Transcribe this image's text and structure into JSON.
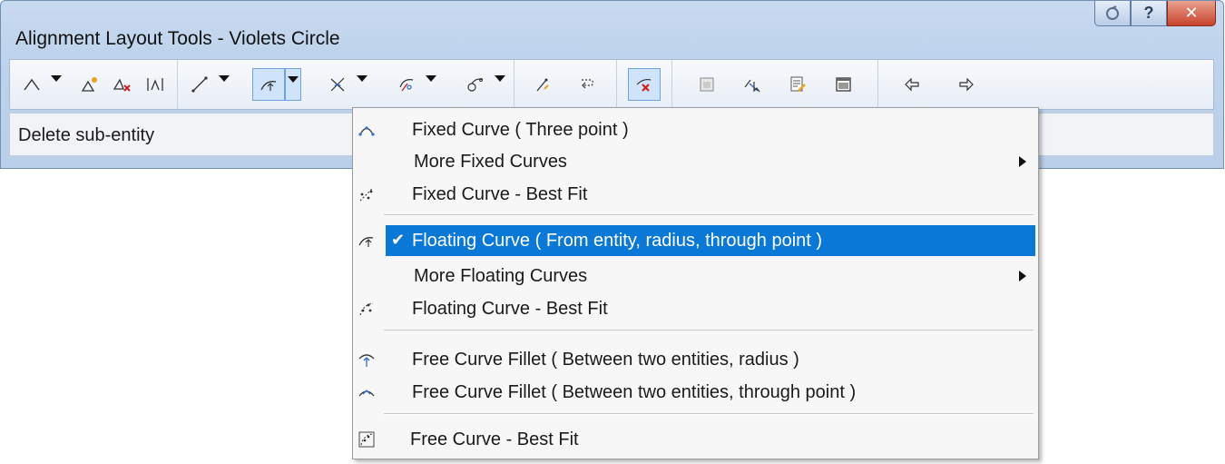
{
  "window": {
    "title": "Alignment Layout Tools - Violets Circle",
    "caption_help": "?",
    "caption_close": "✕"
  },
  "toolbar": {
    "groups": [
      {
        "items": [
          "pi-create-icon",
          "pi-insert-icon",
          "pi-delete-icon",
          "pi-break-icon"
        ]
      },
      {
        "items": [
          "tangent-line-icon",
          "floating-curve-icon",
          "free-curve-icon",
          "spiral-icon",
          "compound-curve-icon"
        ]
      },
      {
        "items": [
          "convert-icon",
          "reverse-icon"
        ]
      },
      {
        "items": [
          "delete-sub-entity-icon"
        ]
      },
      {
        "items": [
          "select-sub-entity-icon",
          "sub-entity-editor-icon",
          "edit-parameters-icon",
          "grid-view-icon"
        ]
      },
      {
        "items": [
          "undo-icon",
          "redo-icon"
        ]
      }
    ],
    "active_tool": "floating-curve-icon"
  },
  "status": {
    "text": "Delete sub-entity"
  },
  "menu": {
    "items": [
      {
        "label": "Fixed Curve ( Three point )",
        "icon": "fixed-curve-three-point-icon",
        "submenu": false
      },
      {
        "label": "More Fixed Curves",
        "icon": "",
        "submenu": true
      },
      {
        "label": "Fixed Curve - Best Fit",
        "icon": "fixed-curve-best-fit-icon",
        "submenu": false
      },
      {
        "label": "Floating Curve ( From entity, radius, through point )",
        "icon": "floating-curve-icon",
        "submenu": false,
        "selected": true
      },
      {
        "label": "More Floating Curves",
        "icon": "",
        "submenu": true
      },
      {
        "label": "Floating Curve - Best Fit",
        "icon": "floating-curve-best-fit-icon",
        "submenu": false
      },
      {
        "label": "Free Curve Fillet ( Between two entities, radius )",
        "icon": "free-curve-fillet-radius-icon",
        "submenu": false
      },
      {
        "label": "Free Curve Fillet ( Between two entities, through point )",
        "icon": "free-curve-fillet-point-icon",
        "submenu": false
      },
      {
        "label": "Free Curve - Best Fit",
        "icon": "free-curve-best-fit-icon",
        "submenu": false
      }
    ],
    "check_mark": "✔"
  },
  "colors": {
    "highlight": "#0a78d7",
    "window_frame": "#b9cfe9",
    "close_button": "#c7432b",
    "delete_red": "#d0201a"
  }
}
